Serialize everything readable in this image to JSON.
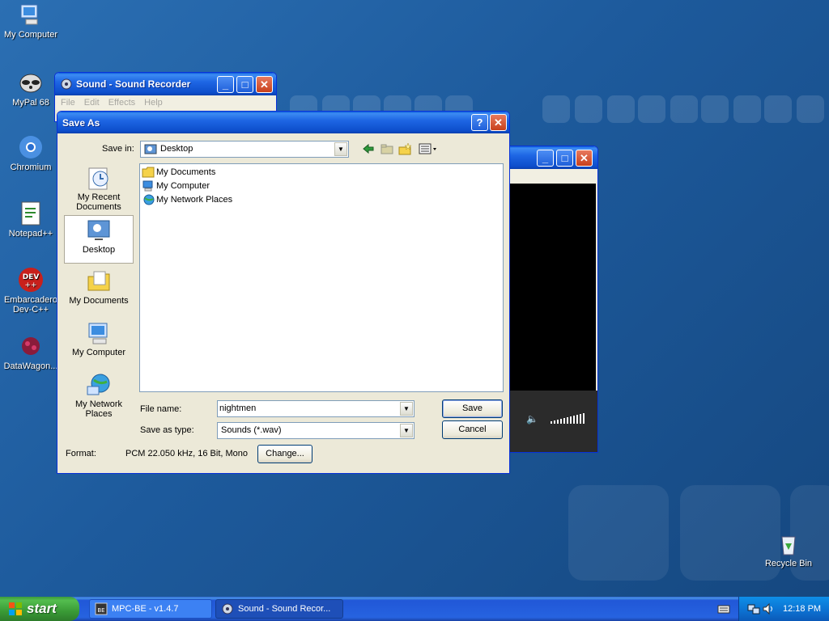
{
  "desktop": {
    "icons": [
      {
        "label": "My Computer",
        "icon": "computer-icon"
      },
      {
        "label": "MyPal 68",
        "icon": "raccoon-icon"
      },
      {
        "label": "Chromium",
        "icon": "chromium-icon"
      },
      {
        "label": "Notepad++",
        "icon": "notepad-icon"
      },
      {
        "label": "Embarcadero Dev-C++",
        "icon": "devcpp-icon"
      },
      {
        "label": "DataWagon...",
        "icon": "datawagon-icon"
      },
      {
        "label": "Recycle Bin",
        "icon": "recycle-bin-icon"
      }
    ]
  },
  "sound_recorder": {
    "title": "Sound - Sound Recorder",
    "menu": [
      "File",
      "Edit",
      "Effects",
      "Help"
    ]
  },
  "save_as": {
    "title": "Save As",
    "save_in_label": "Save in:",
    "save_in_value": "Desktop",
    "places": [
      "My Recent Documents",
      "Desktop",
      "My Documents",
      "My Computer",
      "My Network Places"
    ],
    "selected_place": "Desktop",
    "files": [
      "My Documents",
      "My Computer",
      "My Network Places"
    ],
    "file_name_label": "File name:",
    "file_name_value": "nightmen",
    "save_as_type_label": "Save as type:",
    "save_as_type_value": "Sounds (*.wav)",
    "save_button": "Save",
    "cancel_button": "Cancel",
    "format_label": "Format:",
    "format_value": "PCM 22.050 kHz, 16 Bit, Mono",
    "change_button": "Change...",
    "help_button": "?"
  },
  "taskbar": {
    "start_label": "start",
    "tasks": [
      {
        "label": "MPC-BE - v1.4.7",
        "active": false
      },
      {
        "label": "Sound - Sound Recor...",
        "active": true
      }
    ],
    "clock": "12:18 PM"
  },
  "colors": {
    "desktop": "#1d5a9c",
    "title_bar": "#0d4ecb",
    "dialog_face": "#ece9d8",
    "close_button": "#c8401c",
    "start_button": "#3a9b36"
  }
}
